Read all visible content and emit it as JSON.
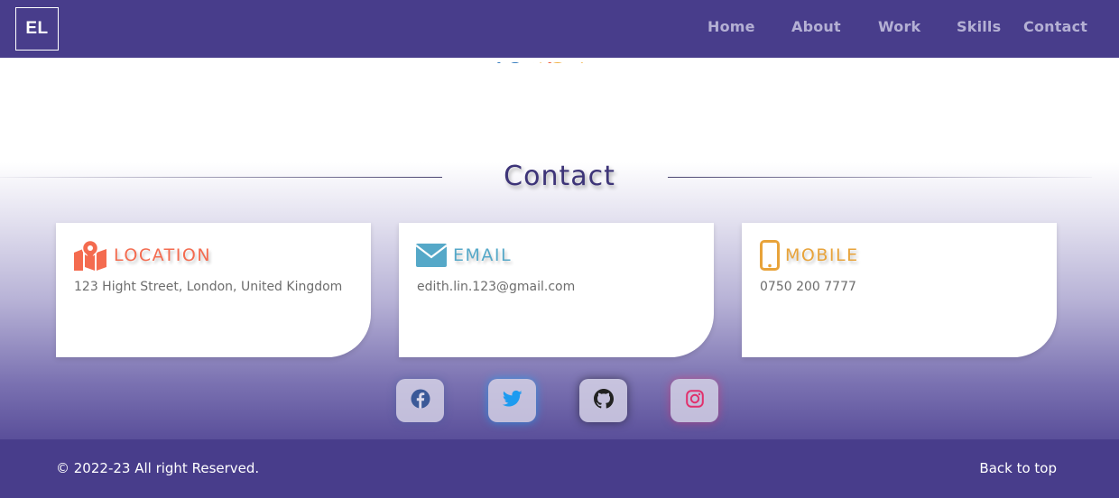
{
  "header": {
    "logo": "EL",
    "nav": [
      {
        "label": "Home"
      },
      {
        "label": "About"
      },
      {
        "label": "Work"
      },
      {
        "label": "Skills"
      },
      {
        "label": "Contact"
      }
    ]
  },
  "contact": {
    "title": "Contact",
    "cards": [
      {
        "icon": "map-location-icon",
        "title": "LOCATION",
        "text": "123 Hight Street, London, United Kingdom",
        "color": "#f46b4f"
      },
      {
        "icon": "envelope-icon",
        "title": "EMAIL",
        "text": "edith.lin.123@gmail.com",
        "color": "#55a8c8"
      },
      {
        "icon": "mobile-phone-icon",
        "title": "MOBILE",
        "text": "0750 200 7777",
        "color": "#e8a33a"
      }
    ],
    "social": [
      {
        "icon": "facebook-icon",
        "color": "#3b5998"
      },
      {
        "icon": "twitter-icon",
        "color": "#1d9bf0"
      },
      {
        "icon": "github-icon",
        "color": "#222222"
      },
      {
        "icon": "instagram-icon",
        "color": "#e1306c"
      }
    ]
  },
  "footer": {
    "copyright": "© 2022-23 All right Reserved.",
    "back_to_top": "Back to top"
  },
  "colors": {
    "brand": "#483d8b",
    "nav_text": "#b4b0d4",
    "title": "#3d3478"
  }
}
